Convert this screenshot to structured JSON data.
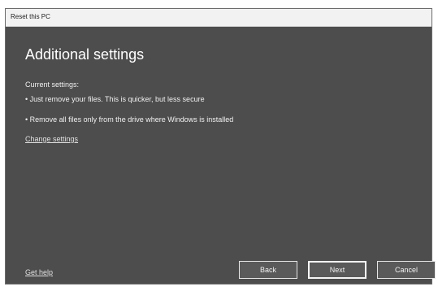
{
  "window": {
    "title": "Reset this PC"
  },
  "main": {
    "heading": "Additional settings",
    "current_label": "Current settings:",
    "bullets": [
      "• Just remove your files. This is quicker, but less secure",
      "• Remove all files only from the drive where Windows is installed"
    ],
    "change_settings_link": "Change settings"
  },
  "footer": {
    "get_help_link": "Get help",
    "back_label": "Back",
    "next_label": "Next",
    "cancel_label": "Cancel"
  }
}
